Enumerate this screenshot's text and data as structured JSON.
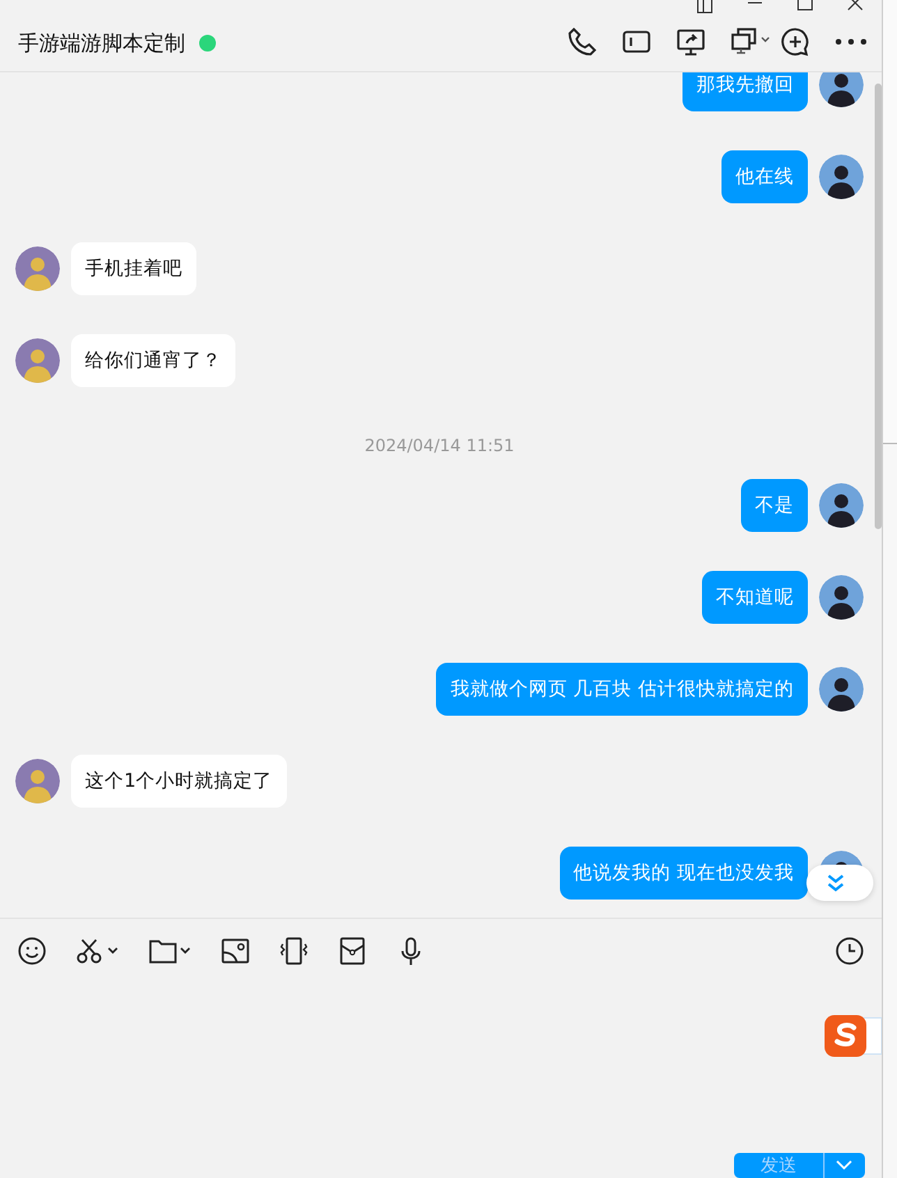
{
  "window": {
    "title": "手游端游脚本定制",
    "online": true
  },
  "messages": [
    {
      "kind": "sent",
      "text": "那我先撤回"
    },
    {
      "kind": "sent",
      "text": "他在线"
    },
    {
      "kind": "received",
      "text": "手机挂着吧"
    },
    {
      "kind": "received",
      "text": "给你们通宵了？"
    },
    {
      "kind": "timestamp",
      "text": "2024/04/14 11:51"
    },
    {
      "kind": "sent",
      "text": "不是"
    },
    {
      "kind": "sent",
      "text": "不知道呢"
    },
    {
      "kind": "sent",
      "text": "我就做个网页 几百块 估计很快就搞定的"
    },
    {
      "kind": "received",
      "text": "这个1个小时就搞定了"
    },
    {
      "kind": "sent",
      "text": "他说发我的 现在也没发我"
    }
  ],
  "send_button": {
    "label": "发送"
  }
}
